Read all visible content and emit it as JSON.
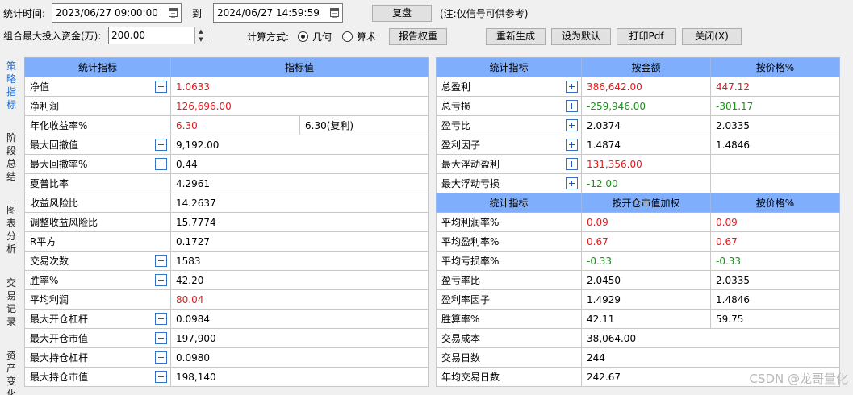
{
  "toolbar": {
    "stat_time_label": "统计时间:",
    "start_datetime": "2023/06/27 09:00:00",
    "to_label": "到",
    "end_datetime": "2024/06/27 14:59:59",
    "replay_button": "复盘",
    "note": "(注:仅信号可供参考)",
    "max_capital_label": "组合最大投入资金(万):",
    "max_capital_value": "200.00",
    "calc_method_label": "计算方式:",
    "radio_geometric": "几何",
    "radio_arithmetic": "算术",
    "report_weight_button": "报告权重",
    "regenerate_button": "重新生成",
    "set_default_button": "设为默认",
    "print_pdf_button": "打印Pdf",
    "close_button": "关闭(X)"
  },
  "side_tabs": [
    "策略指标",
    "阶段总结",
    "图表分析",
    "交易记录",
    "资产变化"
  ],
  "left_table": {
    "headers": [
      "统计指标",
      "指标值"
    ],
    "rows": [
      {
        "name": "净值",
        "value": "1.0633",
        "color": "red",
        "plus": true
      },
      {
        "name": "净利润",
        "value": "126,696.00",
        "color": "red",
        "plus": false
      },
      {
        "name": "年化收益率%",
        "value": "6.30",
        "extra": "6.30(复利)",
        "color": "red",
        "plus": false
      },
      {
        "name": "最大回撤值",
        "value": "9,192.00",
        "color": "black",
        "plus": true
      },
      {
        "name": "最大回撤率%",
        "value": "0.44",
        "color": "black",
        "plus": true
      },
      {
        "name": "夏普比率",
        "value": "4.2961",
        "color": "black",
        "plus": false
      },
      {
        "name": "收益风险比",
        "value": "14.2637",
        "color": "black",
        "plus": false
      },
      {
        "name": "调整收益风险比",
        "value": "15.7774",
        "color": "black",
        "plus": false
      },
      {
        "name": "R平方",
        "value": "0.1727",
        "color": "black",
        "plus": false
      },
      {
        "name": "交易次数",
        "value": "1583",
        "color": "black",
        "plus": true
      },
      {
        "name": "胜率%",
        "value": "42.20",
        "color": "black",
        "plus": true
      },
      {
        "name": "平均利润",
        "value": "80.04",
        "color": "red",
        "plus": false
      },
      {
        "name": "最大开仓杠杆",
        "value": "0.0984",
        "color": "black",
        "plus": true
      },
      {
        "name": "最大开仓市值",
        "value": "197,900",
        "color": "black",
        "plus": true
      },
      {
        "name": "最大持仓杠杆",
        "value": "0.0980",
        "color": "black",
        "plus": true
      },
      {
        "name": "最大持仓市值",
        "value": "198,140",
        "color": "black",
        "plus": true
      }
    ]
  },
  "right_table": {
    "headers1": [
      "统计指标",
      "按金额",
      "按价格%"
    ],
    "rows1": [
      {
        "name": "总盈利",
        "amount": "386,642.00",
        "pct": "447.12",
        "color": "red",
        "plus": true
      },
      {
        "name": "总亏损",
        "amount": "-259,946.00",
        "pct": "-301.17",
        "color": "green",
        "plus": true
      },
      {
        "name": "盈亏比",
        "amount": "2.0374",
        "pct": "2.0335",
        "color": "black",
        "plus": true
      },
      {
        "name": "盈利因子",
        "amount": "1.4874",
        "pct": "1.4846",
        "color": "black",
        "plus": true
      },
      {
        "name": "最大浮动盈利",
        "amount": "131,356.00",
        "pct": "",
        "color": "red",
        "plus": true
      },
      {
        "name": "最大浮动亏损",
        "amount": "-12.00",
        "pct": "",
        "color": "green",
        "plus": true
      }
    ],
    "headers2": [
      "统计指标",
      "按开仓市值加权",
      "按价格%"
    ],
    "rows2": [
      {
        "name": "平均利润率%",
        "amount": "0.09",
        "pct": "0.09",
        "color": "red"
      },
      {
        "name": "平均盈利率%",
        "amount": "0.67",
        "pct": "0.67",
        "color": "red"
      },
      {
        "name": "平均亏损率%",
        "amount": "-0.33",
        "pct": "-0.33",
        "color": "green"
      },
      {
        "name": "盈亏率比",
        "amount": "2.0450",
        "pct": "2.0335",
        "color": "black"
      },
      {
        "name": "盈利率因子",
        "amount": "1.4929",
        "pct": "1.4846",
        "color": "black"
      },
      {
        "name": "胜算率%",
        "amount": "42.11",
        "pct": "59.75",
        "color": "black"
      },
      {
        "name": "交易成本",
        "amount": "38,064.00",
        "pct": null,
        "color": "black"
      },
      {
        "name": "交易日数",
        "amount": "244",
        "pct": null,
        "color": "black"
      },
      {
        "name": "年均交易日数",
        "amount": "242.67",
        "pct": null,
        "color": "black"
      }
    ]
  },
  "watermark": "CSDN @龙哥量化"
}
